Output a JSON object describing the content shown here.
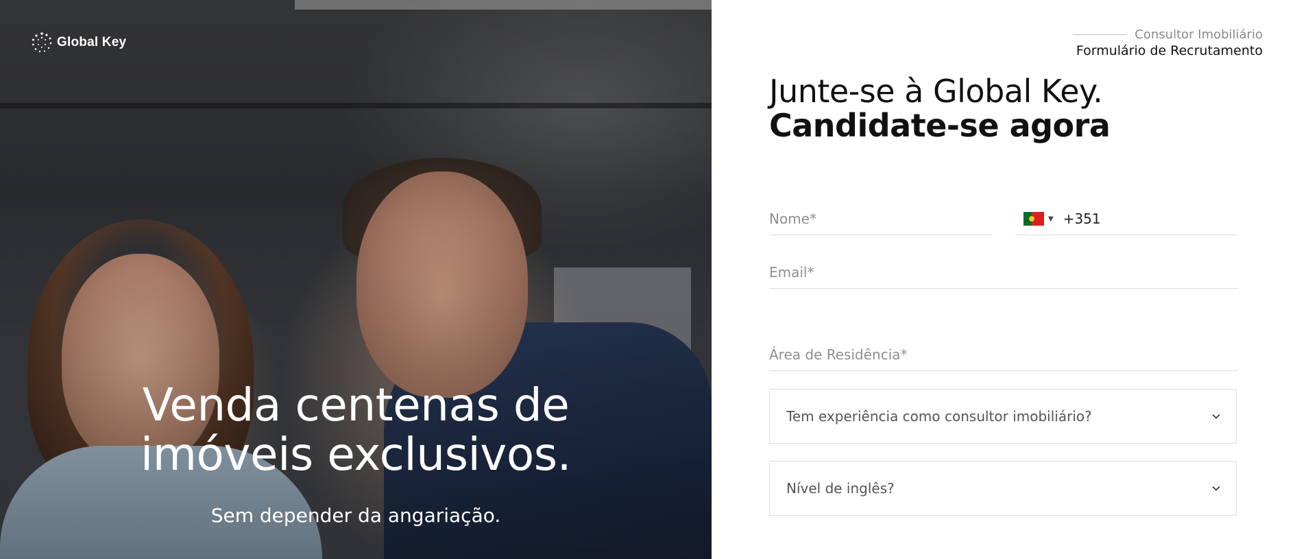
{
  "brand": {
    "name": "Global Key"
  },
  "hero": {
    "title": "Venda centenas de imóveis exclusivos.",
    "subtitle": "Sem depender da angariação."
  },
  "form": {
    "eyebrow": "Consultor Imobiliário",
    "type": "Formulário de Recrutamento",
    "headline_line1": "Junte-se à Global Key.",
    "headline_line2": "Candidate-se agora",
    "name_placeholder": "Nome*",
    "phone_country_code": "+351",
    "phone_country": "Portugal",
    "email_placeholder": "Email*",
    "area_placeholder": "Área de Residência*",
    "experience_select": "Tem experiência como consultor imobiliário?",
    "english_select": "Nível de inglês?"
  },
  "icons": [
    "logo-icon",
    "portugal-flag-icon",
    "caret-down-icon",
    "chevron-down-icon"
  ],
  "colors": {
    "text": "#111111",
    "placeholder": "#8f8f8f",
    "border": "#dedede"
  }
}
